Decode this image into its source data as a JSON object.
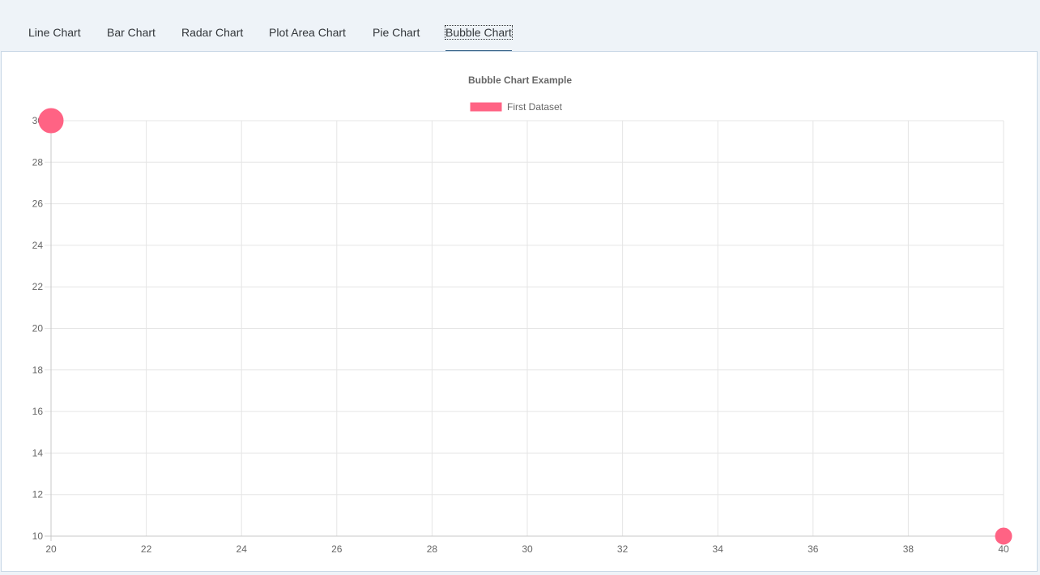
{
  "tabs": [
    {
      "label": "Line Chart",
      "selected": false
    },
    {
      "label": "Bar Chart",
      "selected": false
    },
    {
      "label": "Radar Chart",
      "selected": false
    },
    {
      "label": "Plot Area Chart",
      "selected": false
    },
    {
      "label": "Pie Chart",
      "selected": false
    },
    {
      "label": "Bubble Chart",
      "selected": true
    }
  ],
  "colors": {
    "accent": "#346187",
    "bubble_fill": "#ff6384",
    "grid": "#e5e5e5",
    "axis_text": "#666666"
  },
  "chart_data": {
    "type": "scatter",
    "subtype": "bubble",
    "title": "Bubble Chart Example",
    "legend": {
      "position": "top",
      "entries": [
        "First Dataset"
      ]
    },
    "series": [
      {
        "name": "First Dataset",
        "points": [
          {
            "x": 20,
            "y": 30,
            "r": 15
          },
          {
            "x": 40,
            "y": 10,
            "r": 10
          }
        ]
      }
    ],
    "xlim": [
      20,
      40
    ],
    "ylim": [
      10,
      30
    ],
    "x_ticks": [
      20,
      22,
      24,
      26,
      28,
      30,
      32,
      34,
      36,
      38,
      40
    ],
    "y_ticks": [
      10,
      12,
      14,
      16,
      18,
      20,
      22,
      24,
      26,
      28,
      30
    ],
    "grid": true
  }
}
